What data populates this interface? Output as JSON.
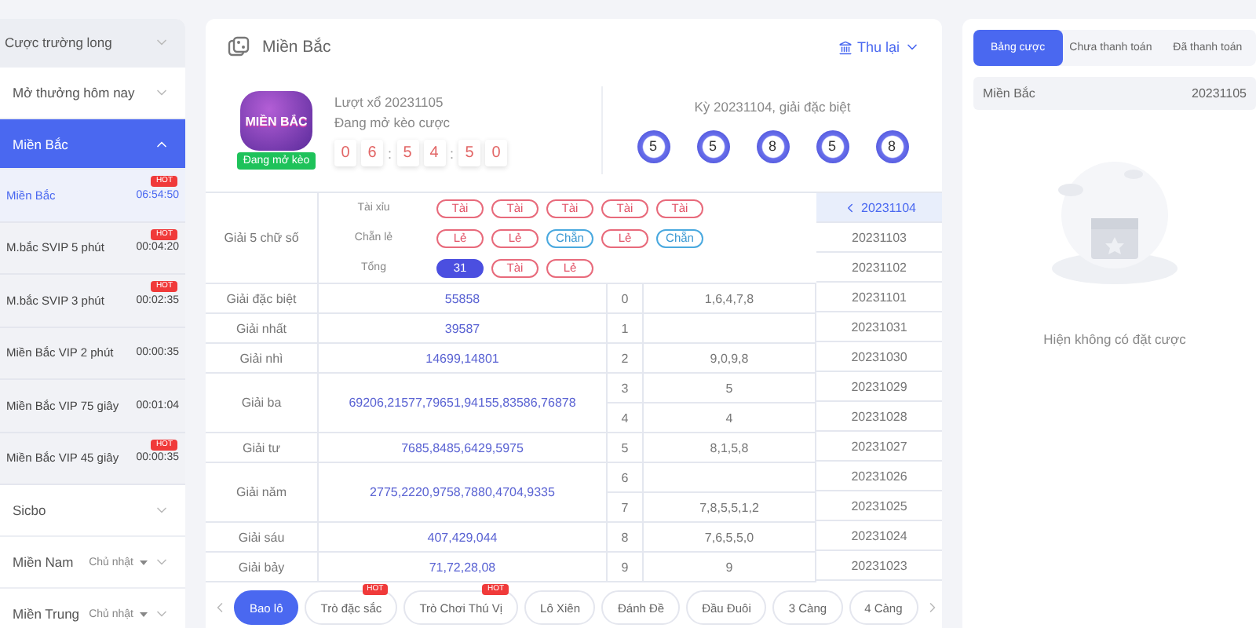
{
  "sidebar": {
    "sections": [
      {
        "kind": "group",
        "label": "Cược trường long",
        "expanded": false,
        "shaded": true
      },
      {
        "kind": "group",
        "label": "Mở thưởng hôm nay",
        "expanded": false,
        "shaded": false
      },
      {
        "kind": "group",
        "label": "Miền Bắc",
        "expanded": true,
        "shaded": false,
        "items": [
          {
            "name": "Miền Bắc",
            "time": "06:54:50",
            "badge": "HOT",
            "selected": true
          },
          {
            "name": "M.bắc SVIP 5 phút",
            "time": "00:04:20",
            "badge": "HOT",
            "selected": false
          },
          {
            "name": "M.bắc SVIP 3 phút",
            "time": "00:02:35",
            "badge": "HOT",
            "selected": false
          },
          {
            "name": "Miền Bắc VIP 2 phút",
            "time": "00:00:35",
            "selected": false
          },
          {
            "name": "Miền Bắc VIP 75 giây",
            "time": "00:01:04",
            "selected": false
          },
          {
            "name": "Miền Bắc VIP 45 giây",
            "time": "00:00:35",
            "badge": "HOT",
            "selected": false
          }
        ]
      },
      {
        "kind": "group",
        "label": "Sicbo",
        "expanded": false,
        "shaded": false
      },
      {
        "kind": "group",
        "label": "Miền Nam",
        "expanded": false,
        "shaded": false,
        "day": "Chủ nhật"
      },
      {
        "kind": "group",
        "label": "Miền Trung",
        "expanded": false,
        "shaded": false,
        "day": "Chủ nhật"
      }
    ]
  },
  "game": {
    "title": "Miền Bắc",
    "collapse_label": "Thu lại",
    "logo_text": "MIỀN BẮC",
    "status_badge": "Đang mở kèo",
    "round": "Lượt xổ 20231105",
    "round_status": "Đang mở kèo cược",
    "countdown": [
      {
        "kind": "digit",
        "text": "0"
      },
      {
        "kind": "digit",
        "text": "6"
      },
      {
        "kind": "sep",
        "text": ":"
      },
      {
        "kind": "digit",
        "text": "5"
      },
      {
        "kind": "digit",
        "text": "4"
      },
      {
        "kind": "sep",
        "text": ":"
      },
      {
        "kind": "digit",
        "text": "5"
      },
      {
        "kind": "digit",
        "text": "0"
      }
    ],
    "last_result_label": "Kỳ 20231104, giải đặc biệt",
    "balls": [
      "5",
      "5",
      "8",
      "5",
      "8"
    ]
  },
  "results": {
    "summary_label": "Giải 5 chữ số",
    "summary_rows": [
      {
        "label": "Tài xỉu",
        "pills": [
          {
            "text": "Tài",
            "kind": "red"
          },
          {
            "text": "Tài",
            "kind": "red"
          },
          {
            "text": "Tài",
            "kind": "red"
          },
          {
            "text": "Tài",
            "kind": "red"
          },
          {
            "text": "Tài",
            "kind": "red"
          }
        ]
      },
      {
        "label": "Chẵn lẻ",
        "pills": [
          {
            "text": "Lẻ",
            "kind": "red"
          },
          {
            "text": "Lẻ",
            "kind": "red"
          },
          {
            "text": "Chẵn",
            "kind": "blue"
          },
          {
            "text": "Lẻ",
            "kind": "red"
          },
          {
            "text": "Chẵn",
            "kind": "blue"
          }
        ]
      },
      {
        "label": "Tổng",
        "pills": [
          {
            "text": "31",
            "kind": "solid"
          },
          {
            "text": "Tài",
            "kind": "red"
          },
          {
            "text": "Lẻ",
            "kind": "red"
          }
        ]
      }
    ],
    "prizes": [
      {
        "name": "Giải đặc biệt",
        "numbers": "55858"
      },
      {
        "name": "Giải nhất",
        "numbers": "39587"
      },
      {
        "name": "Giải nhì",
        "numbers": "14699,14801"
      },
      {
        "name": "Giải ba",
        "numbers": "69206,21577,79651,94155,83586,76878"
      },
      {
        "name": "Giải tư",
        "numbers": "7685,8485,6429,5975"
      },
      {
        "name": "Giải năm",
        "numbers": "2775,2220,9758,7880,4704,9335"
      },
      {
        "name": "Giải sáu",
        "numbers": "407,429,044"
      },
      {
        "name": "Giải bảy",
        "numbers": "71,72,28,08"
      }
    ],
    "heads": [
      {
        "digit": "0",
        "tails": "1,6,4,7,8"
      },
      {
        "digit": "1"
      },
      {
        "digit": "2",
        "tails": "9,0,9,8"
      },
      {
        "digit": "3",
        "tails": "5"
      },
      {
        "digit": "4",
        "tails": "4"
      },
      {
        "digit": "5",
        "tails": "8,1,5,8"
      },
      {
        "digit": "6"
      },
      {
        "digit": "7",
        "tails": "7,8,5,5,1,2"
      },
      {
        "digit": "8",
        "tails": "7,6,5,5,0"
      },
      {
        "digit": "9",
        "tails": "9"
      }
    ],
    "dates": [
      {
        "text": "20231104",
        "selected": true
      },
      {
        "text": "20231103",
        "selected": false
      },
      {
        "text": "20231102",
        "selected": false
      },
      {
        "text": "20231101",
        "selected": false
      },
      {
        "text": "20231031",
        "selected": false
      },
      {
        "text": "20231030",
        "selected": false
      },
      {
        "text": "20231029",
        "selected": false
      },
      {
        "text": "20231028",
        "selected": false
      },
      {
        "text": "20231027",
        "selected": false
      },
      {
        "text": "20231026",
        "selected": false
      },
      {
        "text": "20231025",
        "selected": false
      },
      {
        "text": "20231024",
        "selected": false
      },
      {
        "text": "20231023",
        "selected": false
      }
    ]
  },
  "bet_tabs": [
    {
      "label": "Bao lô",
      "selected": true
    },
    {
      "label": "Trò đặc sắc",
      "selected": false,
      "badge": "HOT"
    },
    {
      "label": "Trò Chơi Thú Vị",
      "selected": false,
      "badge": "HOT"
    },
    {
      "label": "Lô Xiên",
      "selected": false
    },
    {
      "label": "Đánh Đề",
      "selected": false
    },
    {
      "label": "Đầu Đuôi",
      "selected": false
    },
    {
      "label": "3 Càng",
      "selected": false
    },
    {
      "label": "4 Càng",
      "selected": false
    }
  ],
  "bets_panel": {
    "tabs": [
      {
        "label": "Bảng cược",
        "selected": true
      },
      {
        "label": "Chưa thanh toán",
        "selected": false
      },
      {
        "label": "Đã thanh toán",
        "selected": false
      }
    ],
    "game": "Miền Bắc",
    "round": "20231105",
    "empty_text": "Hiện không có đặt cược"
  }
}
